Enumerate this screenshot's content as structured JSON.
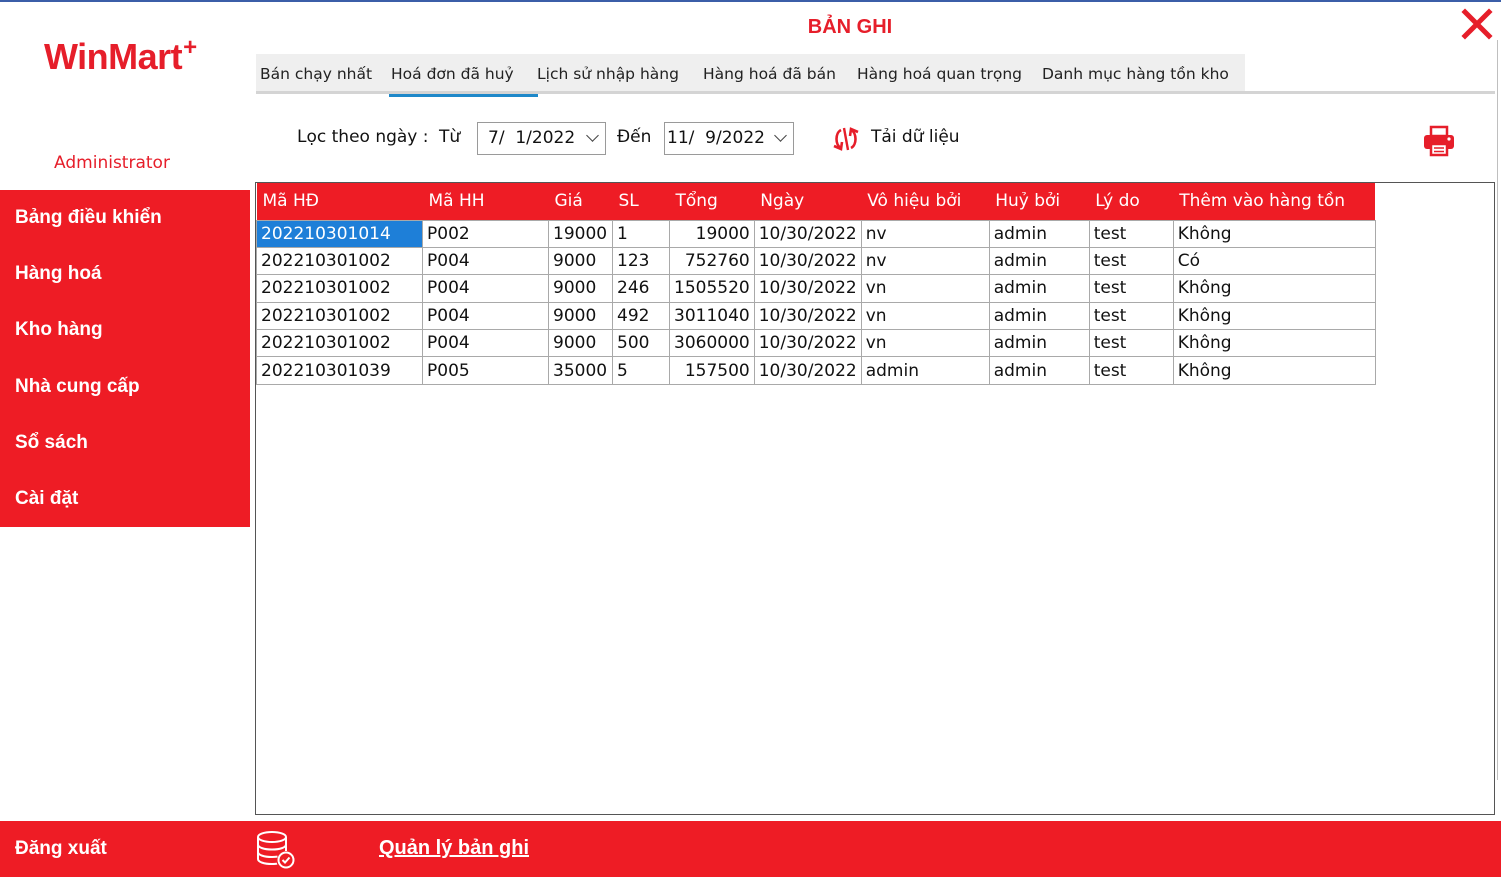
{
  "app": {
    "brand": "WinMart",
    "brand_plus": "+",
    "title": "BẢN GHI",
    "user": "Administrator"
  },
  "tabs": [
    {
      "label": "Bán chạy nhất"
    },
    {
      "label": "Hoá đơn đã huỷ",
      "active": true
    },
    {
      "label": "Lịch sử nhập hàng"
    },
    {
      "label": "Hàng hoá đã bán"
    },
    {
      "label": "Hàng hoá quan trọng"
    },
    {
      "label": "Danh mục hàng tồn kho"
    }
  ],
  "filter": {
    "label": "Lọc theo ngày :",
    "from_label": "Từ",
    "from_value": "7/  1/2022",
    "to_label": "Đến",
    "to_value": "11/  9/2022",
    "reload_label": "Tải dữ liệu"
  },
  "sidebar": {
    "items": [
      {
        "label": "Bảng điều khiển"
      },
      {
        "label": "Hàng hoá"
      },
      {
        "label": "Kho hàng"
      },
      {
        "label": "Nhà cung cấp"
      },
      {
        "label": "Sổ sách"
      },
      {
        "label": "Cài đặt"
      }
    ]
  },
  "grid": {
    "columns": [
      "Mã HĐ",
      "Mã HH",
      "Giá",
      "SL",
      "Tổng",
      "Ngày",
      "Vô hiệu bởi",
      "Huỷ bởi",
      "Lý do",
      "Thêm vào hàng tồn"
    ],
    "rows": [
      [
        "202210301014",
        "P002",
        "19000",
        "1",
        "19000",
        "10/30/2022",
        "nv",
        "admin",
        "test",
        "Không"
      ],
      [
        "202210301002",
        "P004",
        "9000",
        "123",
        "752760",
        "10/30/2022",
        "nv",
        "admin",
        "test",
        "Có"
      ],
      [
        "202210301002",
        "P004",
        "9000",
        "246",
        "1505520",
        "10/30/2022",
        "vn",
        "admin",
        "test",
        "Không"
      ],
      [
        "202210301002",
        "P004",
        "9000",
        "492",
        "3011040",
        "10/30/2022",
        "vn",
        "admin",
        "test",
        "Không"
      ],
      [
        "202210301002",
        "P004",
        "9000",
        "500",
        "3060000",
        "10/30/2022",
        "vn",
        "admin",
        "test",
        "Không"
      ],
      [
        "202210301039",
        "P005",
        "35000",
        "5",
        "157500",
        "10/30/2022",
        "admin",
        "admin",
        "test",
        "Không"
      ]
    ]
  },
  "footer": {
    "logout_label": "Đăng xuất",
    "manage_label": "Quản lý bản ghi"
  },
  "colors": {
    "brand_red": "#ee1c25",
    "selection_blue": "#1e7fd8",
    "tab_active": "#1e88c9"
  }
}
